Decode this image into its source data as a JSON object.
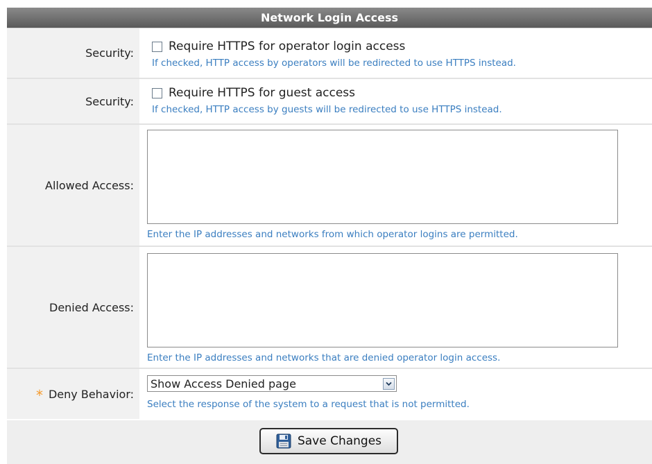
{
  "header": {
    "title": "Network Login Access"
  },
  "rows": {
    "security_operator": {
      "label": "Security:",
      "checkbox_label": "Require HTTPS for operator login access",
      "checked": false,
      "hint": "If checked, HTTP access by operators will be redirected to use HTTPS instead."
    },
    "security_guest": {
      "label": "Security:",
      "checkbox_label": "Require HTTPS for guest access",
      "checked": false,
      "hint": "If checked, HTTP access by guests will be redirected to use HTTPS instead."
    },
    "allowed": {
      "label": "Allowed Access:",
      "value": "",
      "hint": "Enter the IP addresses and networks from which operator logins are permitted."
    },
    "denied": {
      "label": "Denied Access:",
      "value": "",
      "hint": "Enter the IP addresses and networks that are denied operator login access."
    },
    "deny_behavior": {
      "required_mark": "*",
      "label": "Deny Behavior:",
      "selected": "Show Access Denied page",
      "hint": "Select the response of the system to a request that is not permitted."
    }
  },
  "footer": {
    "save_label": "Save Changes",
    "save_icon": "floppy-disk-icon"
  },
  "colors": {
    "header_bg": "#6e6e6e",
    "label_bg": "#f1f1f1",
    "hint_text": "#3a7ec0",
    "required_star": "#f59a2c"
  }
}
